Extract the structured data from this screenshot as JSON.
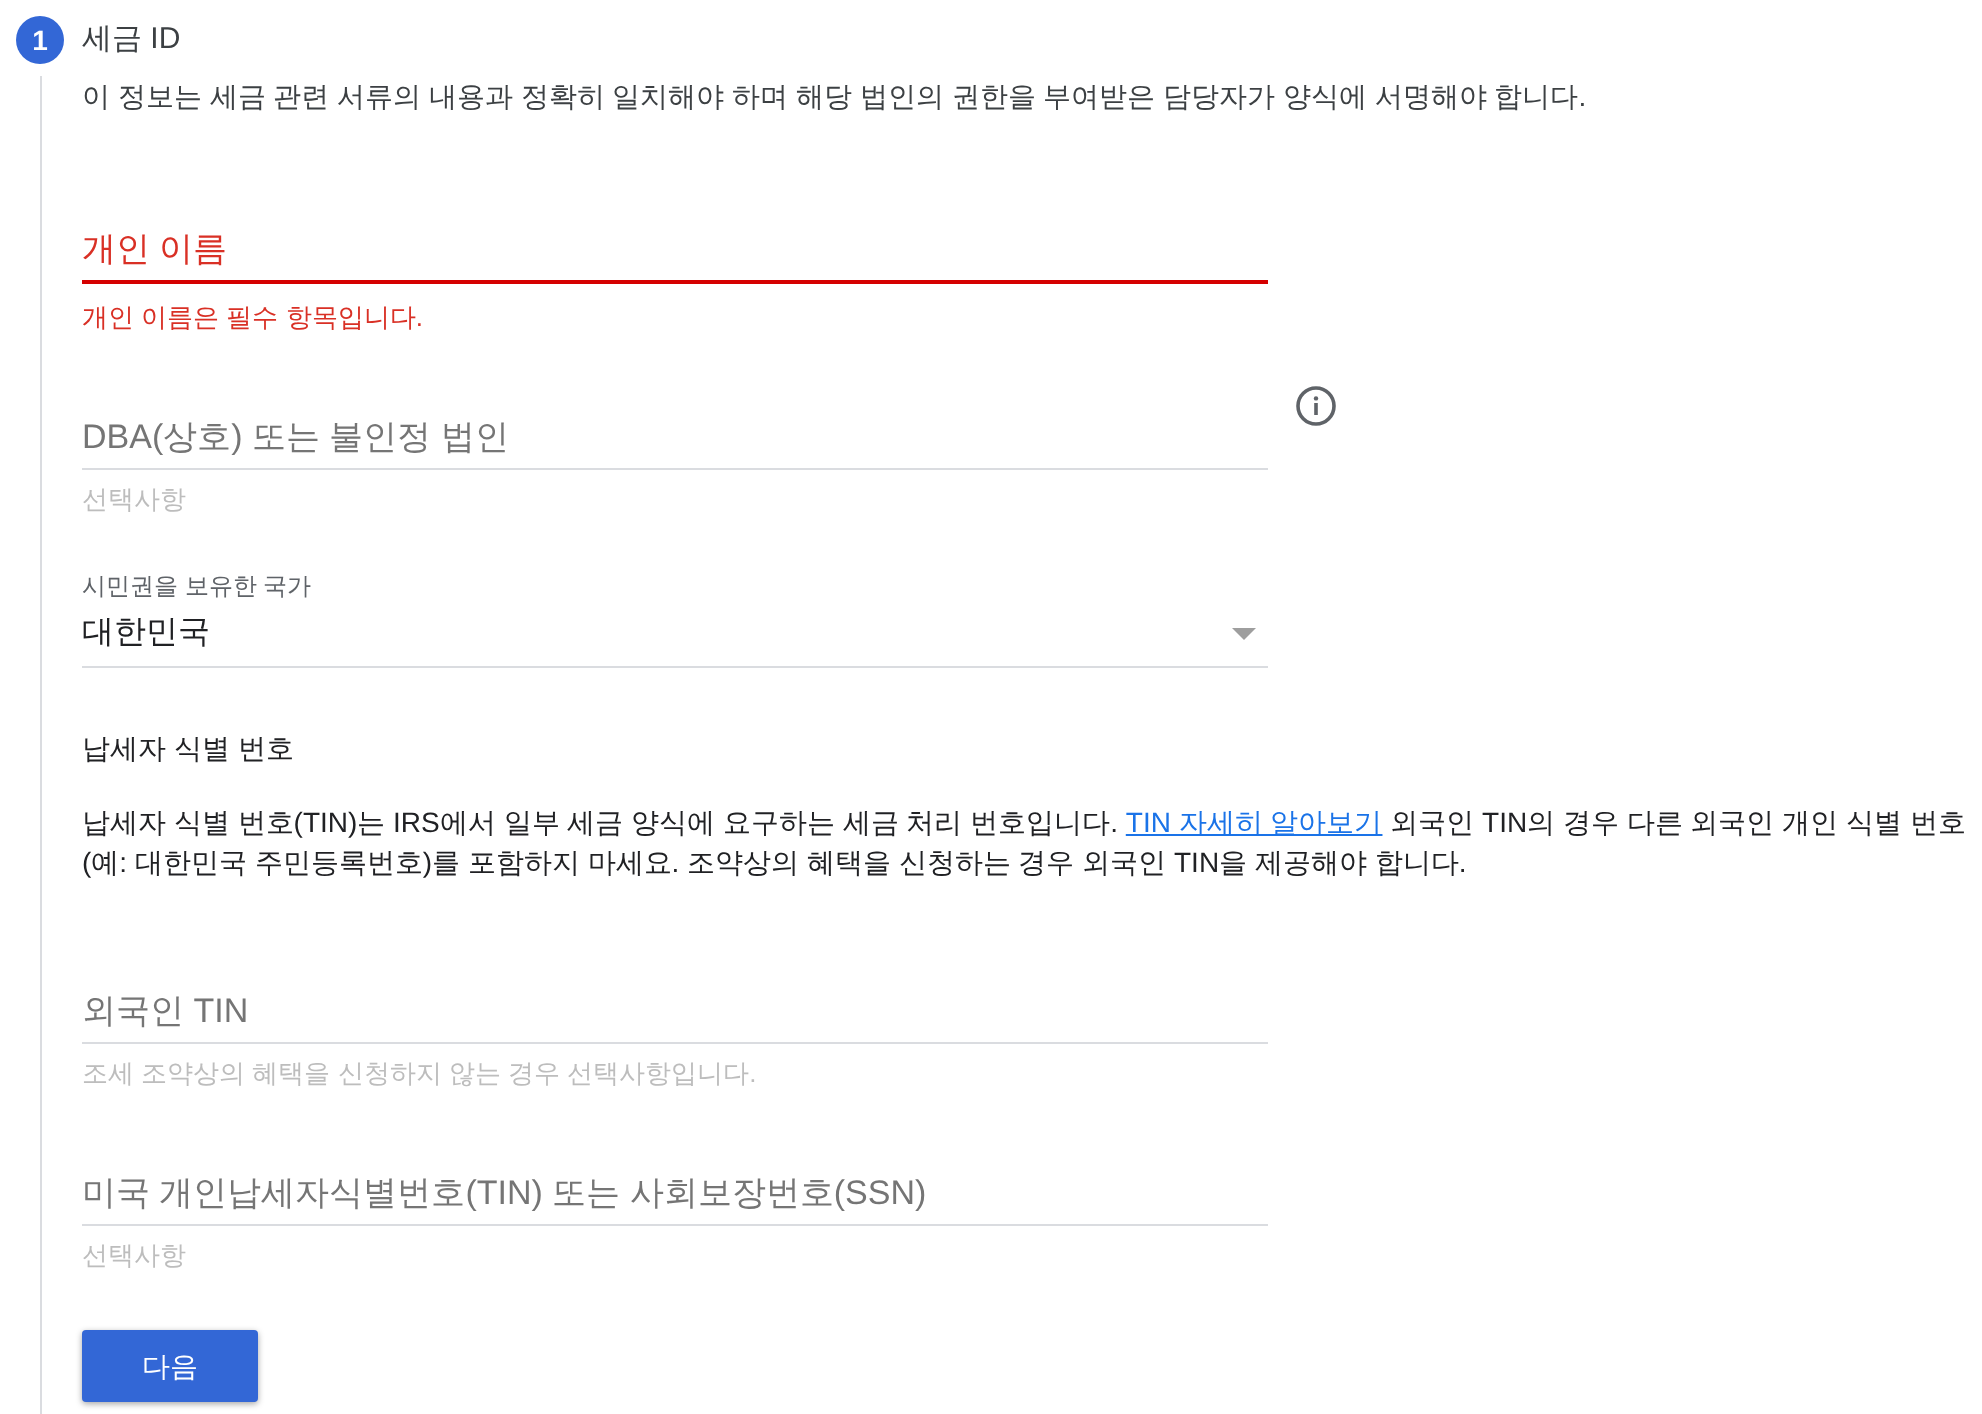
{
  "step": {
    "number": "1",
    "title": "세금 ID",
    "description": "이 정보는 세금 관련 서류의 내용과 정확히 일치해야 하며 해당 법인의 권한을 부여받은 담당자가 양식에 서명해야 합니다."
  },
  "items": [
    {
      "kind": "text_field",
      "placeholder": "개인 이름",
      "invalid": true,
      "info": false,
      "helper": "개인 이름은 필수 항목입니다."
    },
    {
      "kind": "text_field",
      "placeholder": "DBA(상호) 또는 불인정 법인",
      "invalid": false,
      "info": true,
      "helper": "선택사항"
    },
    {
      "kind": "select",
      "label": "시민권을 보유한 국가",
      "value": "대한민국"
    },
    {
      "kind": "heading",
      "text": "납세자 식별 번호"
    },
    {
      "kind": "paragraph",
      "parts": [
        {
          "text": "납세자 식별 번호(TIN)는 IRS에서 일부 세금 양식에 요구하는 세금 처리 번호입니다. ",
          "link": false
        },
        {
          "text": "TIN 자세히 알아보기",
          "link": true
        },
        {
          "text": " 외국인 TIN의 경우 다른 외국인 개인 식별 번호(예: 대한민국 주민등록번호)를 포함하지 마세요. 조약상의 혜택을 신청하는 경우 외국인 TIN을 제공해야 합니다.",
          "link": false
        }
      ]
    },
    {
      "kind": "text_field",
      "placeholder": "외국인 TIN",
      "invalid": false,
      "info": false,
      "helper": "조세 조약상의 혜택을 신청하지 않는 경우 선택사항입니다."
    },
    {
      "kind": "text_field",
      "placeholder": "미국 개인납세자식별번호(TIN) 또는 사회보장번호(SSN)",
      "invalid": false,
      "info": false,
      "helper": "선택사항"
    }
  ],
  "button": {
    "label": "다음"
  }
}
